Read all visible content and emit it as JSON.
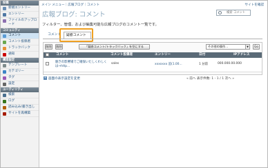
{
  "breadcrumb": "メイン メニュー｜広報ブログ｜コメント",
  "top_link": "サイトを確認",
  "page_title": "広報ブログ: コメント",
  "search": {
    "placeholder": "検索 コメント"
  },
  "description": "フィルター、管理、および編集可能な広報ブログのコメント一覧です。",
  "tabs": [
    {
      "label": "コメント"
    },
    {
      "label": "疑惑コメント"
    }
  ],
  "toolbar": {
    "delete_label": "削除",
    "delete2_label": "削除",
    "clear_spam_label": "「疑惑コメント/トラックバック」を空にする",
    "action_select": "その他の操作...",
    "go_label": "Go"
  },
  "table": {
    "headers": [
      "コメント",
      "コメント投稿者",
      "エントリー",
      "日付",
      "IPアドレス"
    ],
    "rows": [
      {
        "comment": "魅きの影響場でご確保いたしくわしくは→http...",
        "author": "sales",
        "entry": "xxxxxxx 追(1.00...",
        "date": "1 分前",
        "ip": "000.000.00.000"
      }
    ]
  },
  "footer": {
    "link": "画面の表示設定を変更",
    "pager": "« 前へ  表示件数: 1 - 1 / 1  次へ »"
  },
  "sidebar": {
    "sections": [
      {
        "title": "投稿",
        "items": [
          {
            "label": "新規エントリー",
            "icon": "new-entry-icon",
            "color": "#6a8fb5"
          },
          {
            "label": "エントリー",
            "icon": "entries-icon",
            "color": "#4f78a3"
          },
          {
            "label": "ファイルのアップロード",
            "icon": "upload-icon",
            "color": "#8c6fb0"
          }
        ]
      },
      {
        "title": "コミュニティ",
        "items": [
          {
            "label": "コメント",
            "icon": "comment-icon",
            "color": "#5b9bd5",
            "active": true
          },
          {
            "label": "コメント投稿者",
            "icon": "commenter-icon",
            "color": "#6aa84f"
          },
          {
            "label": "トラックバック",
            "icon": "trackback-icon",
            "color": "#e69138"
          },
          {
            "label": "通知",
            "icon": "notification-icon",
            "color": "#cc0000"
          }
        ]
      },
      {
        "title": "構造設定",
        "items": [
          {
            "label": "テンプレート",
            "icon": "template-icon",
            "color": "#7f8c8d"
          },
          {
            "label": "カテゴリー",
            "icon": "category-icon",
            "color": "#3d85c6"
          },
          {
            "label": "タグ",
            "icon": "tag-icon",
            "color": "#9b59b6"
          },
          {
            "label": "設定",
            "icon": "settings-icon",
            "color": "#666666"
          }
        ]
      },
      {
        "title": "ユーティリティ",
        "items": [
          {
            "label": "検索",
            "icon": "search-icon",
            "color": "#4a6f8f"
          },
          {
            "label": "ログ",
            "icon": "log-icon",
            "color": "#38761d"
          },
          {
            "label": "読み込み/書き出し",
            "icon": "import-export-icon",
            "color": "#b45f06"
          },
          {
            "label": "サイトを再構築",
            "icon": "rebuild-icon",
            "color": "#a61c00"
          }
        ]
      }
    ]
  }
}
